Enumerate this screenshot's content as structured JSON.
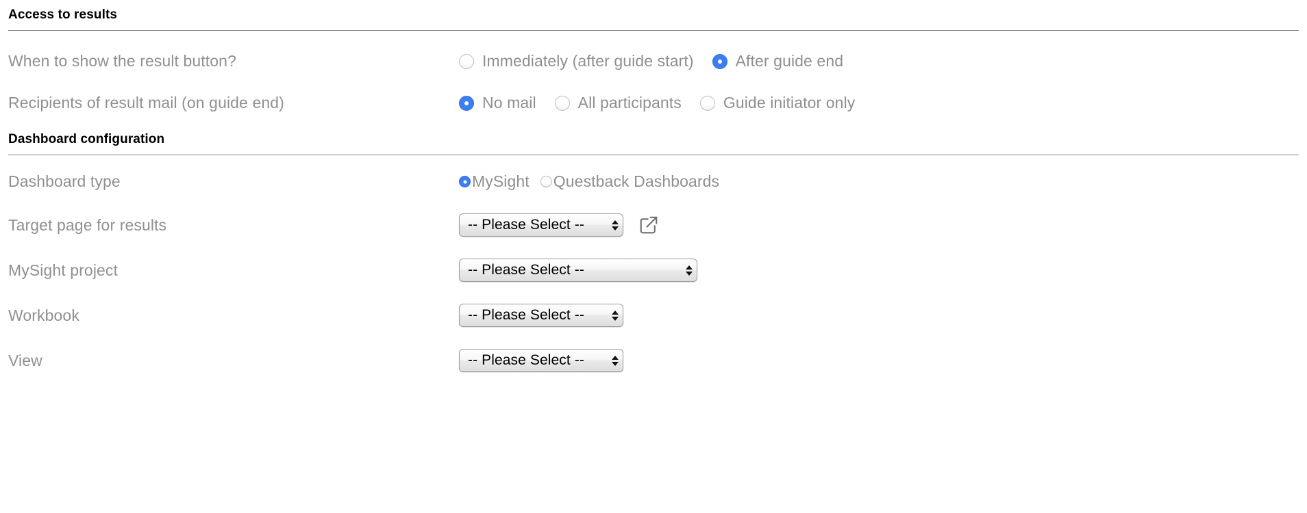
{
  "sections": [
    {
      "heading": "Access to results",
      "rows": [
        {
          "label": "When to show the result button?",
          "type": "radio-group-large",
          "options": [
            {
              "label": "Immediately (after guide start)",
              "selected": false
            },
            {
              "label": "After guide end",
              "selected": true
            }
          ]
        },
        {
          "label": "Recipients of result mail (on guide end)",
          "type": "radio-group-large",
          "options": [
            {
              "label": "No mail",
              "selected": true
            },
            {
              "label": "All participants",
              "selected": false
            },
            {
              "label": "Guide initiator only",
              "selected": false
            }
          ]
        }
      ]
    },
    {
      "heading": "Dashboard configuration",
      "rows": [
        {
          "label": "Dashboard type",
          "type": "radio-group-small",
          "options": [
            {
              "label": "MySight",
              "selected": true
            },
            {
              "label": "Questback Dashboards",
              "selected": false
            }
          ]
        },
        {
          "label": "Target page for results",
          "type": "select",
          "value": "-- Please Select --",
          "width": "narrow",
          "external_link_icon": "external-link-icon"
        },
        {
          "label": "MySight project",
          "type": "select",
          "value": "-- Please Select --",
          "width": "wide"
        },
        {
          "label": "Workbook",
          "type": "select",
          "value": "-- Please Select --",
          "width": "narrow"
        },
        {
          "label": "View",
          "type": "select",
          "value": "-- Please Select --",
          "width": "narrow"
        }
      ]
    }
  ],
  "colors": {
    "accent_blue": "#3d7ef0",
    "label_gray": "#909090",
    "rule_gray": "#808080",
    "heading_black": "#000000"
  }
}
